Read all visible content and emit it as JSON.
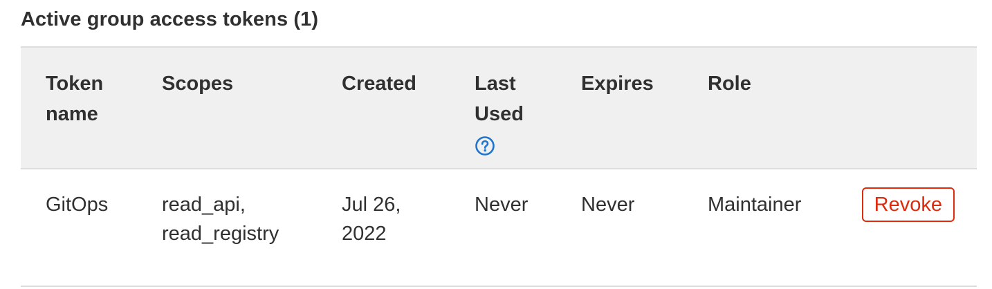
{
  "section": {
    "title": "Active group access tokens (1)"
  },
  "table": {
    "headers": {
      "token_name": "Token name",
      "scopes": "Scopes",
      "created": "Created",
      "last_used": "Last Used",
      "expires": "Expires",
      "role": "Role"
    },
    "help_icon": "question-circle-icon",
    "rows": [
      {
        "token_name": "GitOps",
        "scopes": "read_api, read_registry",
        "created": "Jul 26, 2022",
        "last_used": "Never",
        "expires": "Never",
        "role": "Maintainer",
        "action": "Revoke"
      }
    ]
  },
  "colors": {
    "header_bg": "#f0f0f0",
    "border": "#dcdcde",
    "text": "#303030",
    "link_blue": "#1f75cb",
    "danger": "#dd2b0e"
  }
}
